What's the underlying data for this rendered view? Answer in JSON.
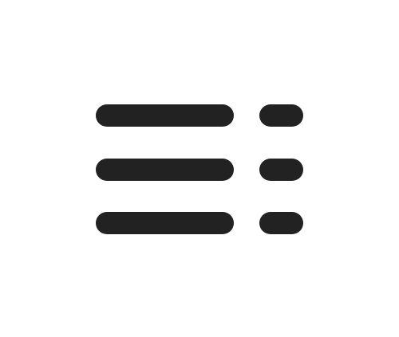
{
  "icon": {
    "name": "list-details-icon",
    "color": "#222222",
    "background": "#ffffff"
  }
}
